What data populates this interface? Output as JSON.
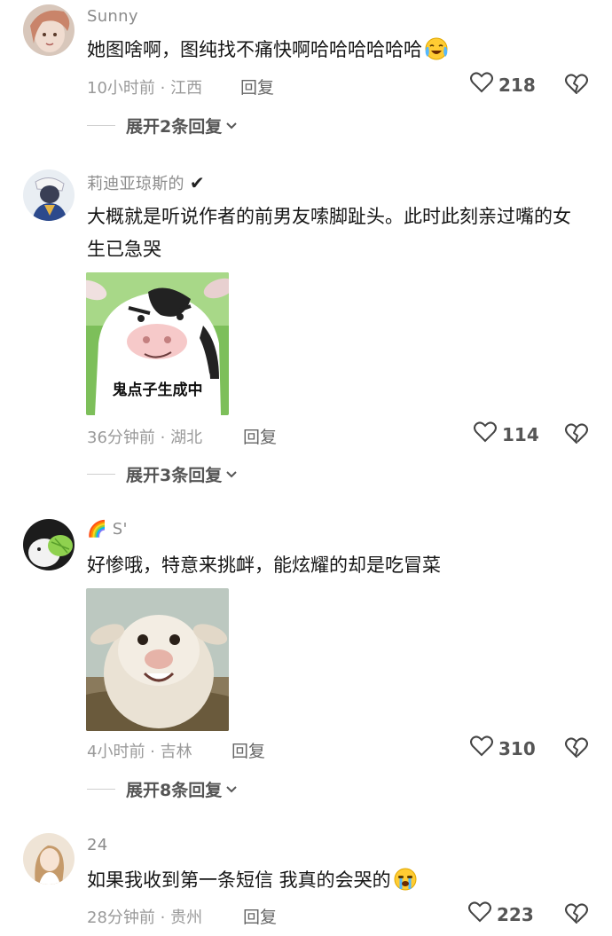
{
  "comments": [
    {
      "username": "Sunny",
      "text": "她图啥啊，图纯找不痛快啊哈哈哈哈哈哈",
      "meta": "10小时前 · 江西",
      "reply": "回复",
      "likes": "218",
      "expand": "展开2条回复"
    },
    {
      "username": "莉迪亚琼斯的",
      "verified_mark": "✔",
      "text": "大概就是听说作者的前男友嗦脚趾头。此时此刻亲过嘴的女生已急哭",
      "sticker_caption": "鬼点子生成中",
      "meta": "36分钟前 · 湖北",
      "reply": "回复",
      "likes": "114",
      "expand": "展开3条回复"
    },
    {
      "username": "S'",
      "username_emoji": "🌈",
      "text": "好惨哦，特意来挑衅，能炫耀的却是吃冒菜",
      "meta": "4小时前 · 吉林",
      "reply": "回复",
      "likes": "310",
      "expand": "展开8条回复"
    },
    {
      "username": "24",
      "text": "如果我收到第一条短信 我真的会哭的",
      "meta": "28分钟前 · 贵州",
      "reply": "回复",
      "likes": "223"
    }
  ],
  "icons": {
    "like": "heart-outline-icon",
    "dislike": "broken-heart-icon",
    "expand": "chevron-down-icon",
    "laugh_cry": "laugh-cry-emoji",
    "sob": "sob-emoji"
  },
  "colors": {
    "text": "#161616",
    "muted": "#9a9a9a",
    "username": "#8c8c8c"
  }
}
